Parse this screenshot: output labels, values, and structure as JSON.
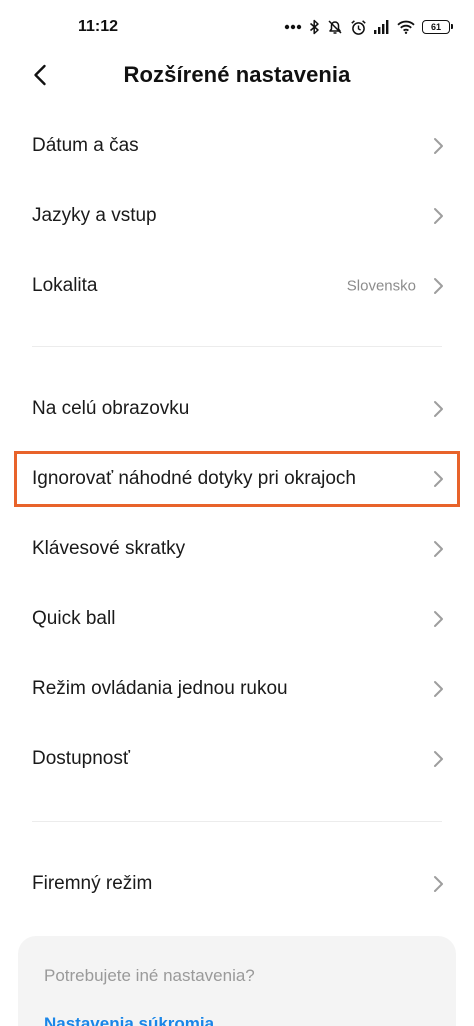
{
  "status_bar": {
    "time": "11:12",
    "battery": "61",
    "icons": [
      "more-dots-icon",
      "bluetooth-icon",
      "alarm-off-icon",
      "alarm-icon",
      "signal-icon",
      "wifi-icon",
      "battery-icon"
    ]
  },
  "header": {
    "title": "Rozšírené nastavenia",
    "back_icon": "chevron-left-icon"
  },
  "sections": [
    {
      "items": [
        {
          "label": "Dátum a čas",
          "value": ""
        },
        {
          "label": "Jazyky a vstup",
          "value": ""
        },
        {
          "label": "Lokalita",
          "value": "Slovensko"
        }
      ]
    },
    {
      "items": [
        {
          "label": "Na celú obrazovku",
          "value": ""
        },
        {
          "label": "Ignorovať náhodné dotyky pri okrajoch",
          "value": "",
          "highlighted": true
        },
        {
          "label": "Klávesové skratky",
          "value": ""
        },
        {
          "label": "Quick ball",
          "value": ""
        },
        {
          "label": "Režim ovládania jednou rukou",
          "value": ""
        },
        {
          "label": "Dostupnosť",
          "value": ""
        }
      ]
    },
    {
      "items": [
        {
          "label": "Firemný režim",
          "value": ""
        }
      ]
    }
  ],
  "help_card": {
    "question": "Potrebujete iné nastavenia?",
    "link": "Nastavenia súkromia"
  },
  "colors": {
    "highlight": "#e8632a",
    "link": "#1a86e8",
    "secondary_text": "#8c8c8c",
    "card_bg": "#f4f4f4"
  }
}
